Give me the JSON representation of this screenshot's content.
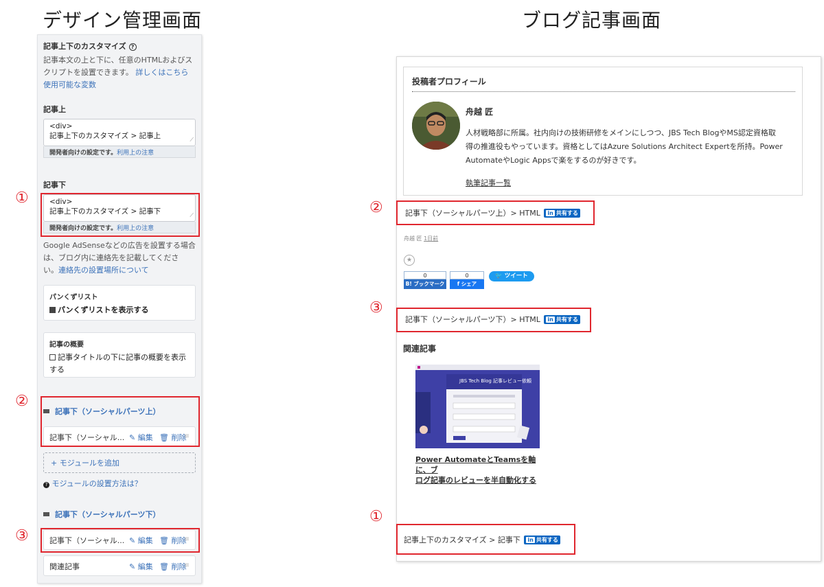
{
  "left_heading": "デザイン管理画面",
  "right_heading": "ブログ記事画面",
  "admin": {
    "section_title": "記事上下のカスタマイズ",
    "help_icon": "help-circle-icon",
    "desc_line1": "記事本文の上と下に、任意のHTMLおよびス",
    "desc_line2_prefix": "クリプトを設置できます。",
    "details_link": "詳しくはこちら",
    "vars_link": "使用可能な変数",
    "top_label": "記事上",
    "top_code_line1": "<div>",
    "top_code_line2": "記事上下のカスタマイズ > 記事上",
    "devnote_text": "開発者向けの設定です。",
    "devnote_link": "利用上の注意",
    "bottom_label": "記事下",
    "bottom_code_line1": "<div>",
    "bottom_code_line2": "記事上下のカスタマイズ > 記事下",
    "adsense_line1": "Google AdSenseなどの広告を設置する場合",
    "adsense_line2": "は、ブログ内に連絡先を記載してくださ",
    "adsense_line3_prefix": "い。",
    "contact_link": "連絡先の設置場所について",
    "breadcrumb_title": "パンくずリスト",
    "breadcrumb_checkbox": "パンくずリストを表示する",
    "summary_title": "記事の概要",
    "summary_line1": "記事タイトルの下に記事の概要を表示",
    "summary_line2": "する",
    "module1_head": "記事下（ソーシャルパーツ上）",
    "module1_row_name": "記事下（ソーシャル...",
    "edit_label": "✎ 編集",
    "delete_label": "🗑 削除",
    "add_module": "+ モジュールを追加",
    "howto": "モジュールの設置方法は？",
    "module2_head": "記事下（ソーシャルパーツ下）",
    "module2_row_name": "記事下（ソーシャル...",
    "module3_row_name": "関連記事"
  },
  "markers": {
    "one": "①",
    "two": "②",
    "three": "③"
  },
  "blog": {
    "profile_title": "投稿者プロフィール",
    "author_name": "舟越 匠",
    "bio_line1": "人材戦略部に所属。社内向けの技術研修をメインにしつつ、JBS Tech BlogやMS認定資格取",
    "bio_line2": "得の推進役もやっています。資格としてはAzure Solutions Architect Expertを所持。Power",
    "bio_line3": "AutomateやLogic Appsで楽をするのが好きです。",
    "articles_link": "執筆記事一覧",
    "line_social_top": "記事下（ソーシャルパーツ上）> HTML",
    "line_social_bottom": "記事下（ソーシャルパーツ下）> HTML",
    "line_bottom": "記事上下のカスタマイズ > 記事下",
    "share_label": "共有する",
    "linkedin_in": "in",
    "meta_author": "舟越 匠",
    "meta_time": "1日前",
    "star_icon": "star-add-icon",
    "bookmark_count": "0",
    "bookmark_label": "B! ブックマーク",
    "facebook_count": "0",
    "facebook_label": "f シェア",
    "tweet_label": "ツイート",
    "related_title": "関連記事",
    "thumb_title": "JBS Tech Blog 記事レビュー依頼",
    "related_link_line1": "Power AutomateとTeamsを軸に、ブ",
    "related_link_line2": "ログ記事のレビューを半自動化する"
  },
  "colors": {
    "accent_link": "#3c72b9",
    "highlight_red": "#e0262e",
    "linkedin_blue": "#0b66c2",
    "twitter_blue": "#1d9bf0"
  }
}
